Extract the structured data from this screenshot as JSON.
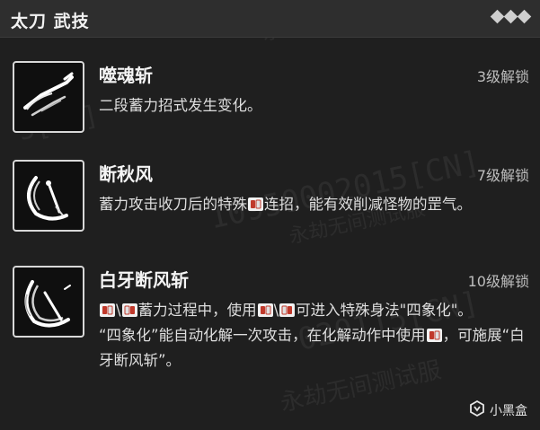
{
  "header": {
    "title": "太刀 武技"
  },
  "watermark": {
    "code": "10950002015[CN]",
    "code_partial_a": "5[CN]",
    "code_partial_b": "020115[CN]",
    "label": "永劫无间测试服",
    "label_partial": "试服"
  },
  "skills": [
    {
      "name": "噬魂斩",
      "unlock": "3级解锁",
      "icon": "slash-blade-icon",
      "desc": [
        "二段蓄力招式发生变化。"
      ]
    },
    {
      "name": "断秋风",
      "unlock": "7级解锁",
      "icon": "crescent-blade-icon",
      "desc_parts": {
        "a": "蓄力攻击收刀后的特殊",
        "b": "连招，能有效削减怪物的罡气。"
      }
    },
    {
      "name": "白牙断风斩",
      "unlock": "10级解锁",
      "icon": "white-fang-icon",
      "desc_parts": {
        "a": "\\",
        "b": "蓄力过程中，使用",
        "c": "\\",
        "d": "可进入特殊身法\"四象化\"。",
        "e": "“四象化”能自动化解一次攻击，在化解动作中使用",
        "f": "，可施展“白牙断风斩”。"
      }
    }
  ],
  "brand": {
    "name": "小黑盒",
    "icon": "heybox-logo-icon"
  },
  "colors": {
    "background": "#1f1f1f",
    "header": "#2e2e2e",
    "button_icon_red": "#c0392b",
    "text": "#dedede"
  }
}
